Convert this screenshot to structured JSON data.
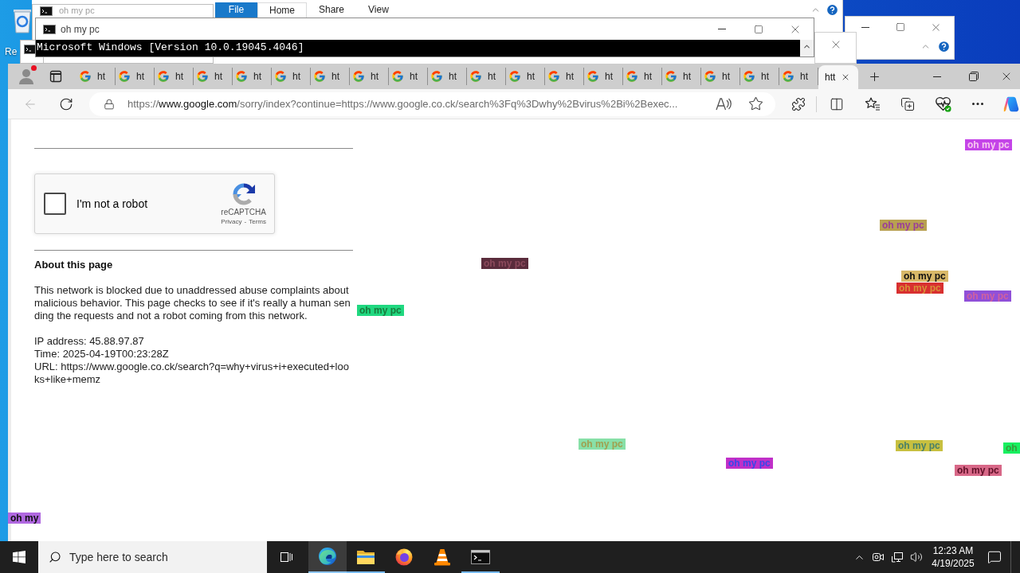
{
  "desktop": {
    "icon_label": "Re"
  },
  "explorer_window": {
    "file_menu": "File",
    "ribbon_tabs": [
      {
        "label": "Home",
        "selected": true
      },
      {
        "label": "Share",
        "selected": false
      },
      {
        "label": "View",
        "selected": false
      }
    ]
  },
  "back_console_window": {
    "title": "oh my pc"
  },
  "console_window": {
    "title": "oh my pc",
    "lines": [
      "Microsoft Windows [Version 10.0.19045.4046]"
    ]
  },
  "browser": {
    "profile": {
      "notification": true
    },
    "tabs": [
      {
        "label": "ht",
        "selected": false
      },
      {
        "label": "ht",
        "selected": false
      },
      {
        "label": "ht",
        "selected": false
      },
      {
        "label": "ht",
        "selected": false
      },
      {
        "label": "ht",
        "selected": false
      },
      {
        "label": "ht",
        "selected": false
      },
      {
        "label": "ht",
        "selected": false
      },
      {
        "label": "ht",
        "selected": false
      },
      {
        "label": "ht",
        "selected": false
      },
      {
        "label": "ht",
        "selected": false
      },
      {
        "label": "ht",
        "selected": false
      },
      {
        "label": "ht",
        "selected": false
      },
      {
        "label": "ht",
        "selected": false
      },
      {
        "label": "ht",
        "selected": false
      },
      {
        "label": "ht",
        "selected": false
      },
      {
        "label": "ht",
        "selected": false
      },
      {
        "label": "ht",
        "selected": false
      },
      {
        "label": "ht",
        "selected": false
      },
      {
        "label": "ht",
        "selected": false
      },
      {
        "label": "htt",
        "selected": true
      }
    ],
    "back_button": {
      "disabled": true
    },
    "address": {
      "scheme": "https://",
      "host": "www.google.com",
      "path": "/sorry/index?continue=https://www.google.co.ck/search%3Fq%3Dwhy%2Bvirus%2Bi%2Bexec..."
    }
  },
  "page": {
    "captcha": {
      "label": "I'm not a robot",
      "checked": false,
      "brand": "reCAPTCHA",
      "links": [
        "Privacy",
        "Terms"
      ],
      "separator": "-"
    },
    "heading": "About this page",
    "paragraph": "This network is blocked due to unaddressed abuse complaints about malicious behavior. This page checks to see if it's really a human sending the requests and not a robot coming from this network.",
    "details": [
      "IP address: 45.88.97.87",
      "Time: 2025-04-19T00:23:28Z",
      "URL: https://www.google.co.ck/search?q=why+virus+i+executed+looks+like+memz"
    ]
  },
  "overlay_labels": [
    {
      "text": "oh my pc",
      "color": "#c444e8"
    },
    {
      "text": "oh my pc",
      "color": "#b8a050"
    },
    {
      "text": "oh my pc",
      "color": "#5a2c3c"
    },
    {
      "text": "oh my pc",
      "color": "#d8b868"
    },
    {
      "text": "oh my pc",
      "color": "#d83030"
    },
    {
      "text": "oh my pc",
      "color": "#9050d8"
    },
    {
      "text": "oh my pc",
      "color": "#20d880"
    },
    {
      "text": "oh my pc",
      "color": "#88e0a8"
    },
    {
      "text": "oh my pc",
      "color": "#c8c040"
    },
    {
      "text": "oh",
      "color": "#18f060"
    },
    {
      "text": "oh my pc",
      "color": "#c030c8"
    },
    {
      "text": "oh my pc",
      "color": "#d86888"
    },
    {
      "text": "oh my",
      "color": "#b068e0"
    }
  ],
  "taskbar": {
    "search": {
      "placeholder": "Type here to search"
    },
    "apps": [
      {
        "kind": "edge",
        "active": true,
        "running": true
      },
      {
        "kind": "explorer",
        "active": false,
        "running": true
      },
      {
        "kind": "firefox",
        "active": false,
        "running": false
      },
      {
        "kind": "vlc",
        "active": false,
        "running": false
      },
      {
        "kind": "terminal",
        "active": false,
        "running": true
      }
    ],
    "time": "12:23 AM",
    "date": "4/19/2025"
  }
}
